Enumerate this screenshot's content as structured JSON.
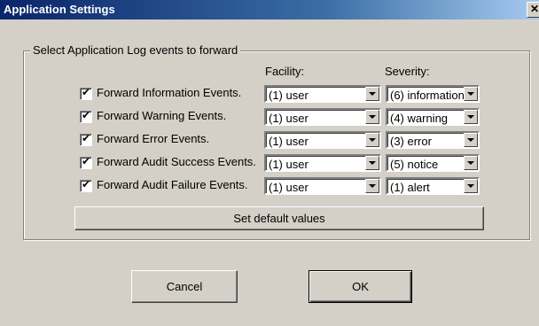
{
  "window": {
    "title": "Application Settings",
    "close_glyph": "✕"
  },
  "group": {
    "label": "Select Application Log events to forward"
  },
  "columns": {
    "facility": "Facility:",
    "severity": "Severity:"
  },
  "rows": [
    {
      "label": "Forward Information Events.",
      "checked": true,
      "facility": "(1) user",
      "severity": "(6) information"
    },
    {
      "label": "Forward Warning Events.",
      "checked": true,
      "facility": "(1) user",
      "severity": "(4) warning"
    },
    {
      "label": "Forward Error Events.",
      "checked": true,
      "facility": "(1) user",
      "severity": "(3) error"
    },
    {
      "label": "Forward Audit Success Events.",
      "checked": true,
      "facility": "(1) user",
      "severity": "(5) notice"
    },
    {
      "label": "Forward Audit Failure Events.",
      "checked": true,
      "facility": "(1) user",
      "severity": "(1) alert"
    }
  ],
  "buttons": {
    "set_default": "Set default values",
    "cancel": "Cancel",
    "ok": "OK"
  },
  "colors": {
    "face": "#d4d0c8",
    "title_start": "#0a246a",
    "title_end": "#a6caf0"
  }
}
